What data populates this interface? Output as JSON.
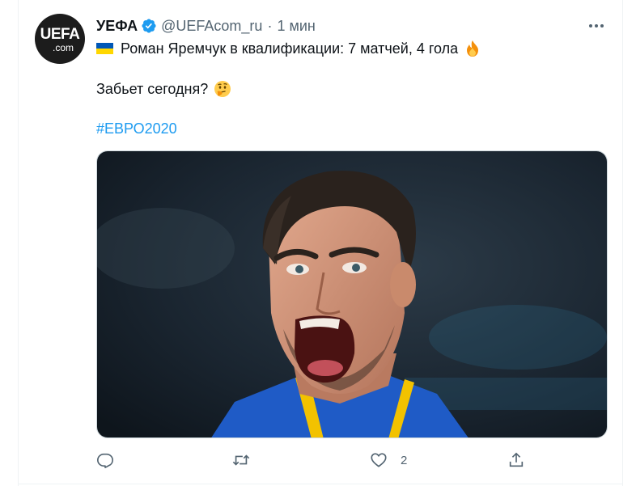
{
  "tweet": {
    "avatar": {
      "logo_main": "UEFA",
      "logo_sub": ".com"
    },
    "author_name": "УЕФА",
    "handle": "@UEFAcom_ru",
    "separator": "·",
    "time": "1 мин",
    "line1": "Роман Яремчук в квалификации: 7 матчей, 4 гола",
    "line2": "Забьет сегодня?",
    "hashtag": "#ЕВРО2020",
    "like_count": "2"
  },
  "colors": {
    "accent": "#1d9bf0",
    "secondary_text": "#536471",
    "flag_blue": "#0057b7",
    "flag_yellow": "#ffd700"
  },
  "icons": [
    "verified-badge-icon",
    "more-options-icon",
    "ukraine-flag-icon",
    "fire-emoji-icon",
    "thinking-emoji-icon",
    "reply-icon",
    "retweet-icon",
    "like-icon",
    "share-icon"
  ]
}
